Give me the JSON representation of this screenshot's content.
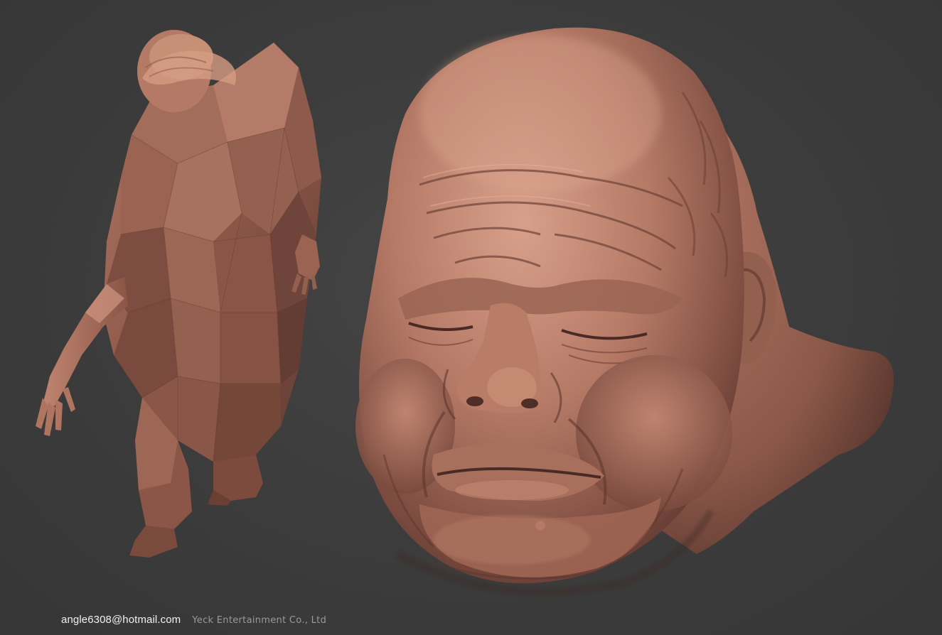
{
  "credits": {
    "email": "angle6308@hotmail.com",
    "company": "Yeck Entertainment Co., Ltd"
  },
  "colors": {
    "background": "#3a3a3a",
    "clay_light": "#c98f78",
    "clay_mid": "#a4695a",
    "clay_dark": "#5e3a32",
    "email_text": "#f2f2f2",
    "company_text": "#9a9a9a"
  },
  "figures": [
    {
      "name": "low-poly-body",
      "description_visible": false
    },
    {
      "name": "sculpted-head",
      "description_visible": false
    }
  ]
}
